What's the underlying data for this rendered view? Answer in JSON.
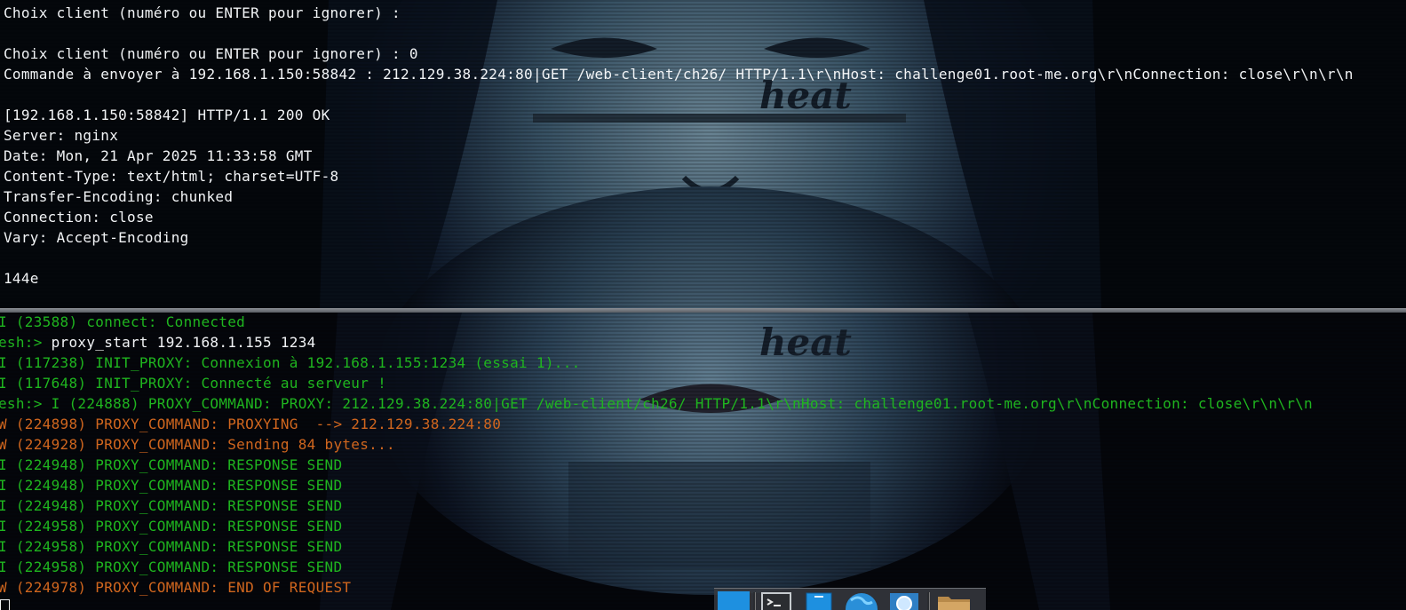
{
  "top_terminal": {
    "lines": [
      "Choix client (numéro ou ENTER pour ignorer) :",
      "",
      "Choix client (numéro ou ENTER pour ignorer) : 0",
      "Commande à envoyer à 192.168.1.150:58842 : 212.129.38.224:80|GET /web-client/ch26/ HTTP/1.1\\r\\nHost: challenge01.root-me.org\\r\\nConnection: close\\r\\n\\r\\n",
      "",
      "[192.168.1.150:58842] HTTP/1.1 200 OK",
      "Server: nginx",
      "Date: Mon, 21 Apr 2025 11:33:58 GMT",
      "Content-Type: text/html; charset=UTF-8",
      "Transfer-Encoding: chunked",
      "Connection: close",
      "Vary: Accept-Encoding",
      "",
      "144e"
    ]
  },
  "bottom_terminal": {
    "line_0": {
      "text": "I (23588) connect: Connected"
    },
    "line_1": {
      "prompt": "esh:> ",
      "command": "proxy_start 192.168.1.155 1234"
    },
    "line_2": {
      "text": "I (117238) INIT_PROXY: Connexion à 192.168.1.155:1234 (essai 1)..."
    },
    "line_3": {
      "text": "I (117648) INIT_PROXY: Connecté au serveur !"
    },
    "line_4": {
      "text": "esh:> I (224888) PROXY_COMMAND: PROXY: 212.129.38.224:80|GET /web-client/ch26/ HTTP/1.1\\r\\nHost: challenge01.root-me.org\\r\\nConnection: close\\r\\n\\r\\n"
    },
    "line_5": {
      "text": "W (224898) PROXY_COMMAND: PROXYING  --> 212.129.38.224:80"
    },
    "line_6": {
      "text": "W (224928) PROXY_COMMAND: Sending 84 bytes..."
    },
    "line_7": {
      "text": "I (224948) PROXY_COMMAND: RESPONSE SEND"
    },
    "line_8": {
      "text": "I (224948) PROXY_COMMAND: RESPONSE SEND"
    },
    "line_9": {
      "text": "I (224948) PROXY_COMMAND: RESPONSE SEND"
    },
    "line_10": {
      "text": "I (224958) PROXY_COMMAND: RESPONSE SEND"
    },
    "line_11": {
      "text": "I (224958) PROXY_COMMAND: RESPONSE SEND"
    },
    "line_12": {
      "text": "I (224958) PROXY_COMMAND: RESPONSE SEND"
    },
    "line_13": {
      "text": "W (224978) PROXY_COMMAND: END OF REQUEST"
    }
  },
  "wallpaper": {
    "logo_text": "heat"
  },
  "dock": {
    "items": [
      "show-desktop-icon",
      "terminal-icon",
      "editor-icon",
      "browser-globe-icon",
      "search-icon",
      "folder-icon"
    ]
  },
  "colors": {
    "info": "#1fb51f",
    "warning": "#d0661e",
    "text": "#f2f4f6",
    "accent": "#1e90e0"
  }
}
